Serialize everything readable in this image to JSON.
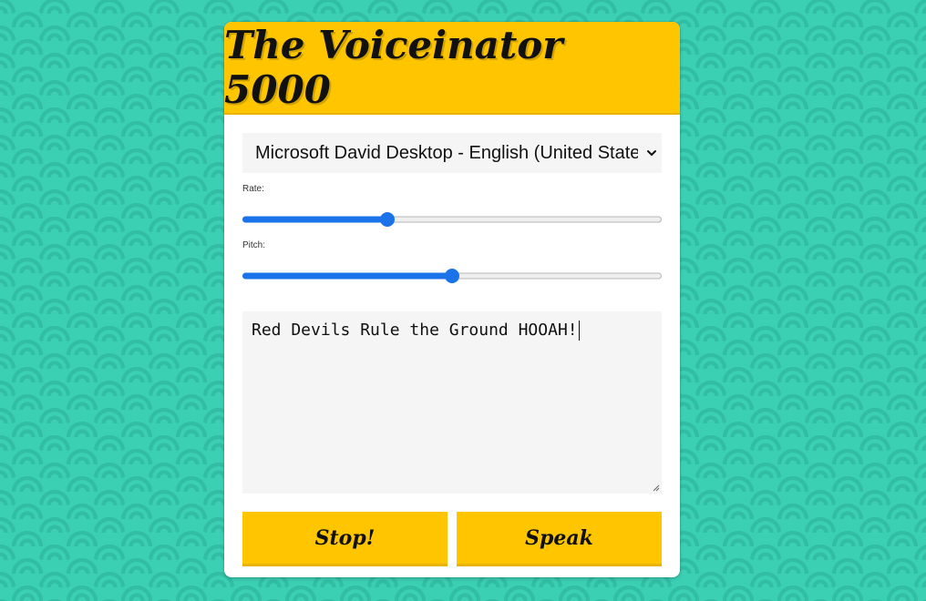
{
  "app": {
    "title": "The Voiceinator 5000"
  },
  "voice_select": {
    "selected": "Microsoft David Desktop - English (United States)",
    "icon": "chevron-down-icon"
  },
  "rate": {
    "label": "Rate:",
    "value_fraction": 0.345
  },
  "pitch": {
    "label": "Pitch:",
    "value_fraction": 0.5
  },
  "text_input": {
    "value": "Red Devils Rule the Ground HOOAH!"
  },
  "buttons": {
    "stop_label": "Stop!",
    "speak_label": "Speak"
  },
  "colors": {
    "accent": "#ffc600",
    "background": "#3bcfb4",
    "slider": "#1a73e8"
  }
}
